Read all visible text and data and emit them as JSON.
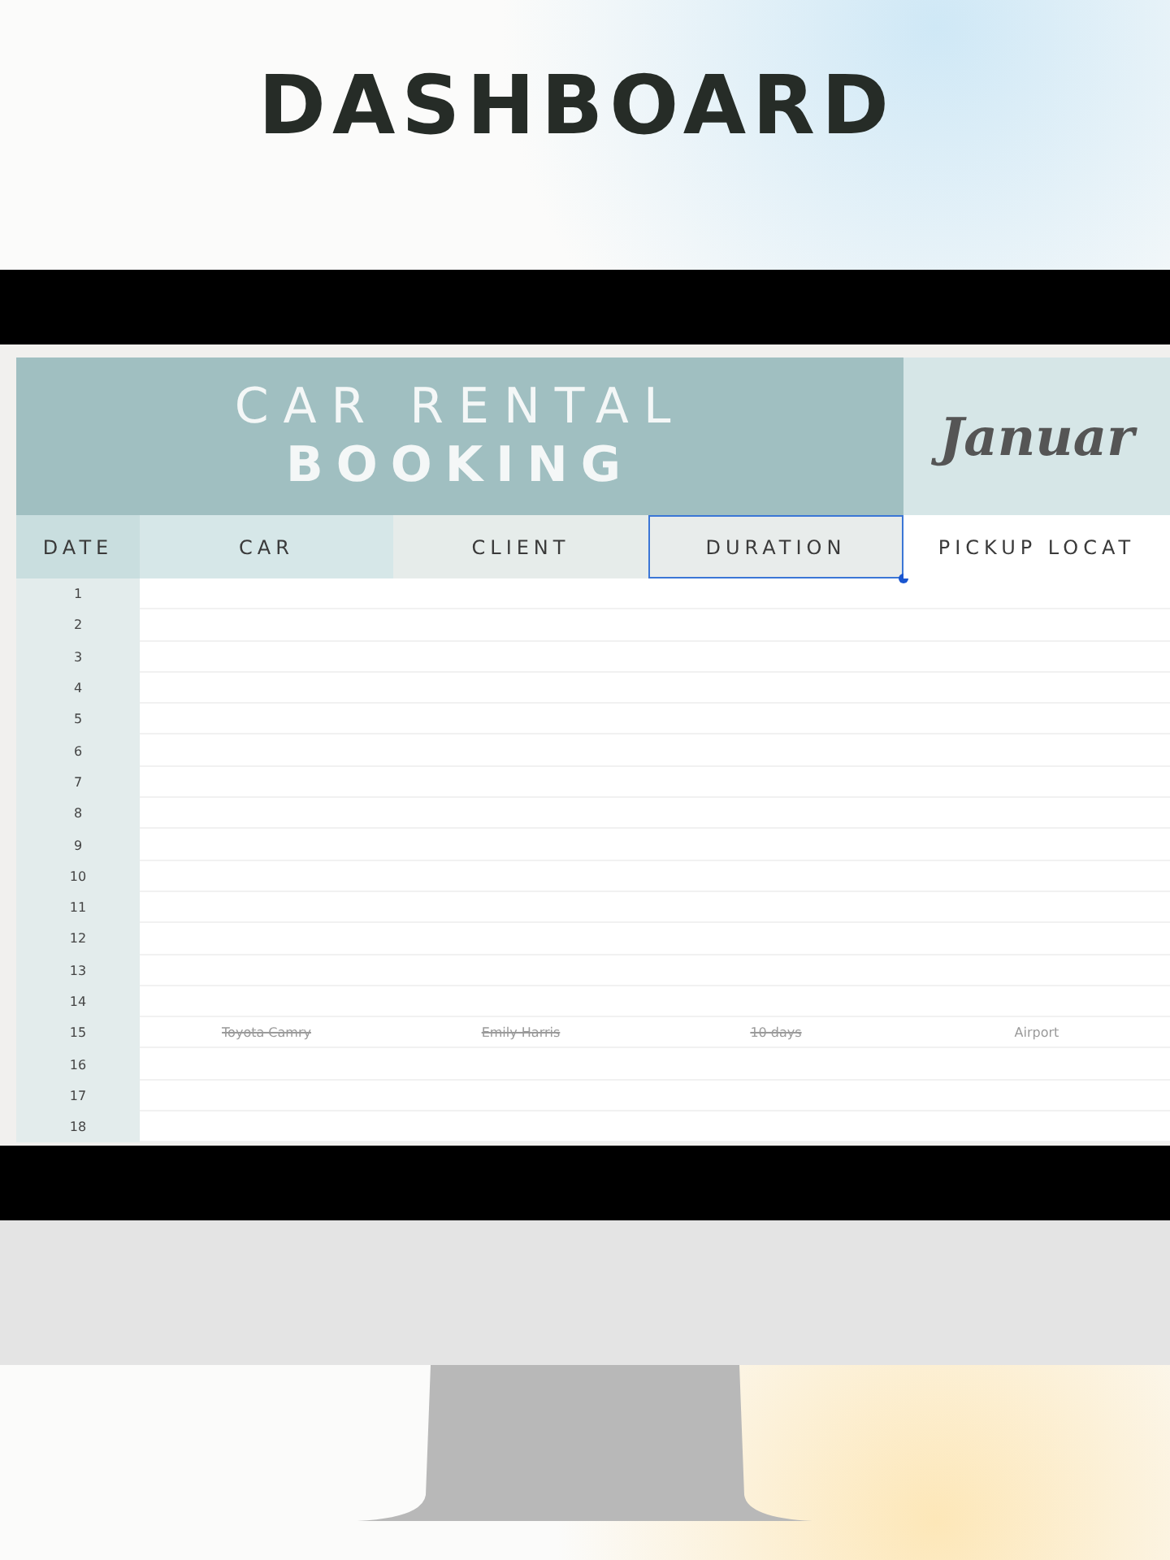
{
  "page_title": "DASHBOARD",
  "sheet": {
    "title_lines": [
      "CAR RENTAL",
      "BOOKING"
    ],
    "month": "Januar",
    "columns": [
      {
        "label": "DATE",
        "selected": false
      },
      {
        "label": "CAR",
        "selected": false
      },
      {
        "label": "CLIENT",
        "selected": false
      },
      {
        "label": "DURATION",
        "selected": true
      },
      {
        "label": "PICKUP LOCAT",
        "selected": false
      }
    ],
    "rows": [
      {
        "number": "1"
      },
      {
        "number": "2"
      },
      {
        "number": "3"
      },
      {
        "number": "4"
      },
      {
        "number": "5"
      },
      {
        "number": "6"
      },
      {
        "number": "7"
      },
      {
        "number": "8"
      },
      {
        "number": "9"
      },
      {
        "number": "10"
      },
      {
        "number": "11"
      },
      {
        "number": "12"
      },
      {
        "number": "13"
      },
      {
        "number": "14"
      },
      {
        "number": "15",
        "cells": [
          {
            "text": "Toyota Camry",
            "struck": true
          },
          {
            "text": "Emily Harris",
            "struck": true
          },
          {
            "text": "10 days",
            "struck": true
          },
          {
            "text": "Airport",
            "struck": false
          }
        ]
      },
      {
        "number": "16"
      },
      {
        "number": "17"
      },
      {
        "number": "18"
      }
    ]
  }
}
